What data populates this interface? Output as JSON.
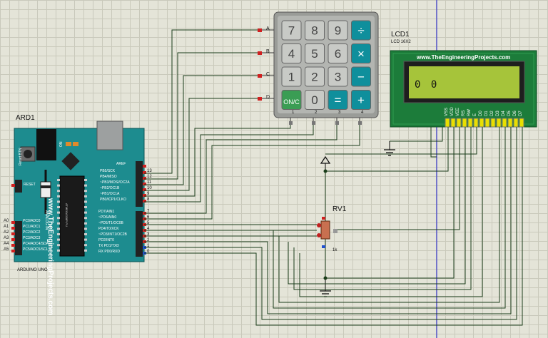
{
  "keypad": {
    "keys": [
      [
        "7",
        "8",
        "9",
        "÷"
      ],
      [
        "4",
        "5",
        "6",
        "×"
      ],
      [
        "1",
        "2",
        "3",
        "−"
      ],
      [
        "ON/C",
        "0",
        "=",
        "+"
      ]
    ],
    "row_labels": [
      "A",
      "B",
      "C",
      "D"
    ],
    "col_labels": [
      "1",
      "2",
      "3",
      "4"
    ]
  },
  "lcd": {
    "ref": "LCD1",
    "model": "LCD 16X2",
    "website": "www.TheEngineeringProjects.com",
    "display_text": "0 0",
    "pins": [
      "VSS",
      "VDD",
      "VEE",
      "RS",
      "RW",
      "E",
      "D0",
      "D1",
      "D2",
      "D3",
      "D4",
      "D5",
      "D6",
      "D7"
    ]
  },
  "arduino": {
    "ref": "ARD1",
    "model": "ARDUINO UNO",
    "website": "www.TheEngineeringProjects.com",
    "reset_label": "Reset BTN",
    "on_label": "ON",
    "aref_label": "AREF",
    "reset_pin_label": "RESET",
    "analog_in_label": "ANALOG IN",
    "chip_label": "ATMEGA328P-PU",
    "digital_right_top": [
      {
        "name": "PB5/SCK",
        "num": "13"
      },
      {
        "name": "PB4/MISO",
        "num": "12"
      },
      {
        "name": "~PB3/MOSI/OC2A",
        "num": "11"
      },
      {
        "name": "~PB2/OC1B",
        "num": "10"
      },
      {
        "name": "~PB1/OC1A",
        "num": "9"
      },
      {
        "name": "PB0/ICP1/CLKO",
        "num": "8"
      }
    ],
    "digital_right_bottom": [
      {
        "name": "PD7/AIN1",
        "num": "7"
      },
      {
        "name": "~PD6/AIN0",
        "num": "6"
      },
      {
        "name": "~PD5/T1/OC0B",
        "num": "5"
      },
      {
        "name": "PD4/T0/XCK",
        "num": "4"
      },
      {
        "name": "~PD3/INT1/OC2B",
        "num": "3"
      },
      {
        "name": "PD2/INT0",
        "num": "2"
      },
      {
        "name": "TX PD1/TXD",
        "num": "1"
      },
      {
        "name": "RX PD0/RXD",
        "num": "0"
      }
    ],
    "analog_left": [
      {
        "name": "PC0/ADC0",
        "num": "A0"
      },
      {
        "name": "PC1/ADC1",
        "num": "A1"
      },
      {
        "name": "PC2/ADC2",
        "num": "A2"
      },
      {
        "name": "PC3/ADC3",
        "num": "A3"
      },
      {
        "name": "PC4/ADC4/SDA",
        "num": "A4"
      },
      {
        "name": "PC5/ADC5/SCL",
        "num": "A5"
      }
    ]
  },
  "pot": {
    "ref": "RV1",
    "value": "1k"
  },
  "colors": {
    "board": "#1d8c8f",
    "lcd_green": "#a6c43a",
    "lcd_frame": "#167a3a",
    "wire": "#1a3d1a",
    "key": "#c8cac6",
    "key_accent": "#0f8f9c"
  }
}
